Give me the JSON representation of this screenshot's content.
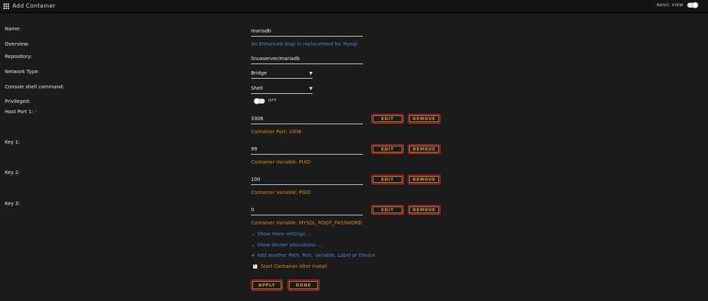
{
  "header": {
    "title": "Add Container",
    "basic_view_label": "BASIC VIEW"
  },
  "form": {
    "name": {
      "label": "Name:",
      "value": "mariadb"
    },
    "overview": {
      "label": "Overview:",
      "value": "An Enhanced drop in replacement for Mysql"
    },
    "repository": {
      "label": "Repository:",
      "value": "linuxserver/mariadb"
    },
    "network_type": {
      "label": "Network Type:",
      "value": "Bridge"
    },
    "console_shell": {
      "label": "Console shell command:",
      "value": "Shell"
    },
    "privileged": {
      "label": "Privileged:",
      "state": "OFF"
    },
    "host_port_1": {
      "label": "Host Port 1:",
      "required_mark": "*",
      "value": "3306",
      "note": "Container Port: 3306"
    },
    "key_1": {
      "label": "Key 1:",
      "value": "99",
      "note": "Container Variable: PUID"
    },
    "key_2": {
      "label": "Key 2:",
      "value": "100",
      "note": "Container Variable: PGID"
    },
    "key_3": {
      "label": "Key 3:",
      "value": "0",
      "note": "Container Variable: MYSQL_ROOT_PASSWORD"
    }
  },
  "buttons": {
    "edit": "EDIT",
    "remove": "REMOVE",
    "apply": "APPLY",
    "done": "DONE"
  },
  "links": {
    "more_settings": "Show more settings ...",
    "docker_allocations": "Show docker allocations ...",
    "add_another": "Add another Path, Port, Variable, Label or Device"
  },
  "options": {
    "start_after_install": "Start Container After Install",
    "start_after_install_checked": true
  },
  "icons": {
    "menu": "grid-icon",
    "expand": "chevron-down-icon",
    "add": "plus-icon",
    "dropdown": "caret-down-icon"
  },
  "colors": {
    "background": "#1c1b1b",
    "accent_orange": "#e8872a",
    "accent_red": "#e0232d",
    "link_blue": "#4a87d8",
    "note_orange": "#e08a12"
  }
}
